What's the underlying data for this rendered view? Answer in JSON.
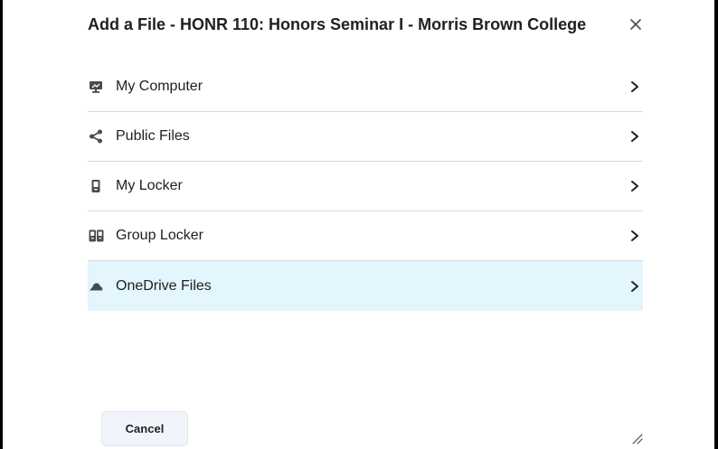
{
  "dialog": {
    "title": "Add a File - HONR 110: Honors Seminar I - Morris Brown College",
    "close_icon": "close-icon"
  },
  "options": [
    {
      "label": "My Computer",
      "icon": "monitor-icon",
      "selected": false
    },
    {
      "label": "Public Files",
      "icon": "share-icon",
      "selected": false
    },
    {
      "label": "My Locker",
      "icon": "locker-icon",
      "selected": false
    },
    {
      "label": "Group Locker",
      "icon": "group-locker-icon",
      "selected": false
    },
    {
      "label": "OneDrive Files",
      "icon": "cloud-icon",
      "selected": true
    }
  ],
  "footer": {
    "cancel_label": "Cancel"
  },
  "colors": {
    "selected_row_bg": "#e3f5fd",
    "divider": "#d3d9e3",
    "text": "#202122"
  }
}
